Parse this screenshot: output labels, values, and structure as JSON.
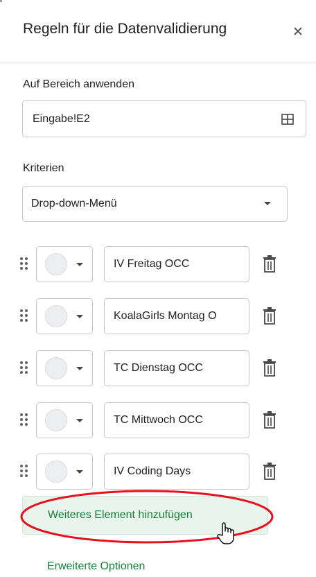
{
  "panel": {
    "title": "Regeln für die Datenvalidierung",
    "close_icon": "close-icon"
  },
  "range": {
    "label": "Auf Bereich anwenden",
    "value": "Eingabe!E2",
    "icon": "grid-select-icon"
  },
  "criteria": {
    "label": "Kriterien",
    "selected": "Drop-down-Menü"
  },
  "items": [
    {
      "value": "IV Freitag OCC",
      "chip_color": "#edeef0"
    },
    {
      "value": "KoalaGirls Montag O",
      "chip_color": "#edeef0"
    },
    {
      "value": "TC Dienstag OCC",
      "chip_color": "#edeef0"
    },
    {
      "value": "TC Mittwoch OCC",
      "chip_color": "#edeef0"
    },
    {
      "value": "IV Coding Days",
      "chip_color": "#edeef0"
    }
  ],
  "actions": {
    "add_item": "Weiteres Element hinzufügen",
    "advanced": "Erweiterte Optionen"
  },
  "colors": {
    "accent_green": "#188038",
    "highlight_red": "#e8101c"
  }
}
